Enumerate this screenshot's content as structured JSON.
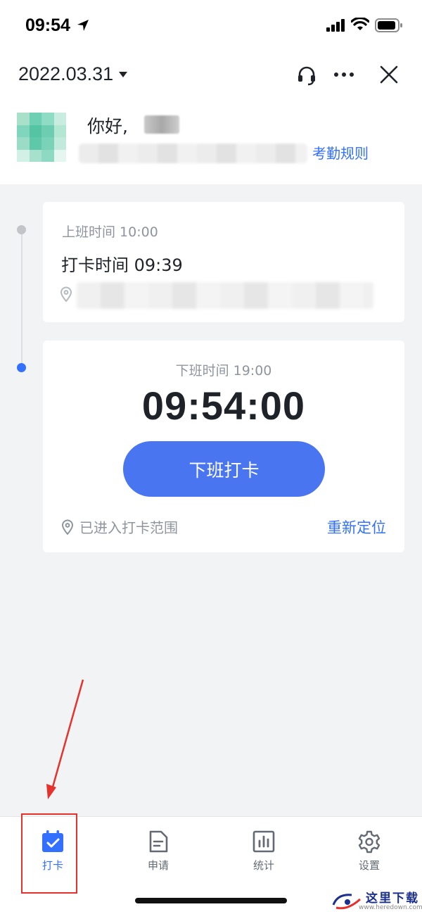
{
  "status_bar": {
    "time": "09:54"
  },
  "header": {
    "date": "2022.03.31",
    "greeting": "你好,",
    "rules_link": "考勤规则"
  },
  "clock_in": {
    "label": "上班时间 10:00",
    "punch_time": "打卡时间 09:39"
  },
  "clock_out": {
    "label": "下班时间 19:00",
    "current_time": "09:54:00",
    "button_label": "下班打卡",
    "range_status": "已进入打卡范围",
    "relocate_link": "重新定位"
  },
  "bottom_nav": {
    "items": [
      {
        "label": "打卡",
        "icon": "calendar-check-icon",
        "active": true
      },
      {
        "label": "申请",
        "icon": "document-icon",
        "active": false
      },
      {
        "label": "统计",
        "icon": "bar-chart-icon",
        "active": false
      },
      {
        "label": "设置",
        "icon": "gear-icon",
        "active": false
      }
    ]
  },
  "watermark": {
    "title": "这里下载",
    "url": "www.heredown.com"
  },
  "colors": {
    "accent": "#3370ff",
    "button": "#4a75f0",
    "annotation": "#e5322d",
    "background": "#f2f3f5"
  }
}
